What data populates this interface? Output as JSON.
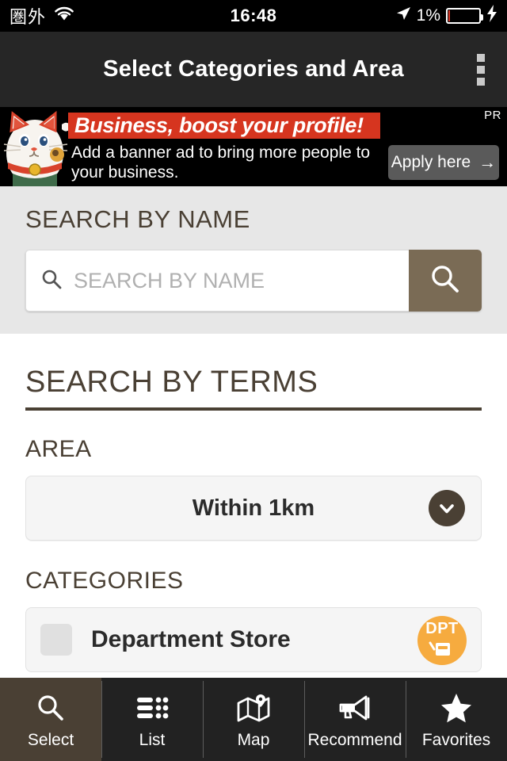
{
  "status_bar": {
    "carrier": "圏外",
    "wifi_icon": "wifi-icon",
    "time": "16:48",
    "location_icon": "location-arrow-icon",
    "battery_percent": "1%",
    "battery_icon": "battery-icon",
    "charging_icon": "lightning-bolt-icon"
  },
  "titlebar": {
    "title": "Select Categories and Area",
    "overflow_icon": "overflow-menu-icon"
  },
  "ad": {
    "pr_label": "PR",
    "headline": "Business, boost your profile!",
    "body": "Add a banner ad to bring more people to your business.",
    "button_label": "Apply here",
    "button_arrow": "→",
    "image_icon": "maneki-neko-cat-image",
    "headline_bg": "#d6351f",
    "button_bg": "#5a5a5a"
  },
  "search_by_name": {
    "section_label": "SEARCH BY NAME",
    "input_value": "",
    "input_placeholder": "SEARCH BY NAME",
    "field_icon": "search-icon",
    "button_icon": "search-icon",
    "button_color": "#7a6b55"
  },
  "search_by_terms": {
    "section_title": "SEARCH BY TERMS",
    "area": {
      "label": "AREA",
      "selected": "Within 1km",
      "chevron_icon": "chevron-down-icon",
      "options": [
        "Within 1km"
      ]
    },
    "categories": {
      "label": "CATEGORIES",
      "items": [
        {
          "name": "Department Store",
          "checked": false,
          "badge_text": "DPT",
          "badge_color": "#f6ab3f",
          "badge_icon": "department-store-icon"
        }
      ]
    }
  },
  "bottom_nav": {
    "active_color": "#4a4034",
    "items": [
      {
        "label": "Select",
        "icon": "search-icon",
        "active": true
      },
      {
        "label": "List",
        "icon": "list-icon",
        "active": false
      },
      {
        "label": "Map",
        "icon": "map-icon",
        "active": false
      },
      {
        "label": "Recommend",
        "icon": "megaphone-icon",
        "active": false
      },
      {
        "label": "Favorites",
        "icon": "star-icon",
        "active": false
      }
    ]
  }
}
